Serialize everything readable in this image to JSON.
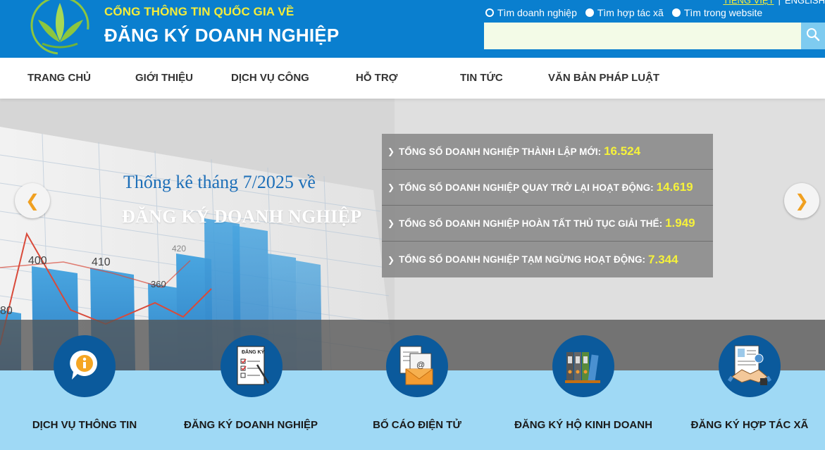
{
  "header": {
    "subtitle": "CỔNG THÔNG TIN QUỐC GIA VỀ",
    "title": "ĐĂNG KÝ DOANH NGHIỆP",
    "lang_vi": "TIẾNG VIỆT",
    "lang_en": "ENGLISH",
    "lang_sep": "|",
    "logo_icon": "leaf-logo-icon"
  },
  "search": {
    "options": [
      {
        "label": "Tìm doanh nghiệp",
        "checked": true
      },
      {
        "label": "Tìm hợp tác xã",
        "checked": false
      },
      {
        "label": "Tìm trong website",
        "checked": false
      }
    ],
    "placeholder": "",
    "value": "",
    "button_icon": "search-icon"
  },
  "nav": {
    "items": [
      "TRANG CHỦ",
      "GIỚI THIỆU",
      "DỊCH VỤ CÔNG",
      "HỖ TRỢ",
      "TIN TỨC",
      "VĂN BẢN PHÁP LUẬT"
    ]
  },
  "hero": {
    "line1": "Thống kê tháng 7/2025 về",
    "line2": "ĐĂNG KÝ DOANH NGHIỆP",
    "chart_labels": [
      "400",
      "410",
      "360",
      "420",
      "80"
    ],
    "stats": [
      {
        "label": "TỔNG SỐ DOANH NGHIỆP THÀNH LẬP MỚI:",
        "value": "16.524"
      },
      {
        "label": "TỔNG SỐ DOANH NGHIỆP QUAY TRỞ LẠI HOẠT ĐỘNG:",
        "value": "14.619"
      },
      {
        "label": "TỔNG SỐ DOANH NGHIỆP HOÀN TẤT THỦ TỤC GIẢI THỂ:",
        "value": "1.949"
      },
      {
        "label": "TỔNG SỐ DOANH NGHIỆP TẠM NGỪNG HOẠT ĐỘNG:",
        "value": "7.344"
      }
    ],
    "prev_icon": "chevron-left-icon",
    "next_icon": "chevron-right-icon"
  },
  "services": [
    {
      "label": "DỊCH VỤ THÔNG TIN",
      "icon": "info-bubble-icon"
    },
    {
      "label": "ĐĂNG KÝ DOANH NGHIỆP",
      "icon": "registration-form-icon",
      "icon_text": "ĐĂNG KÝ"
    },
    {
      "label": "BỐ CÁO ĐIỆN TỬ",
      "icon": "email-document-icon"
    },
    {
      "label": "ĐĂNG KÝ HỘ KINH DOANH",
      "icon": "binders-icon"
    },
    {
      "label": "ĐĂNG KÝ HỢP TÁC XÃ",
      "icon": "handshake-contract-icon"
    }
  ],
  "colors": {
    "header_bg": "#0a7fcf",
    "subtitle": "#f4ec3a",
    "stat_number": "#f6f23a",
    "service_circle": "#0b5a9c",
    "service_strip": "#9fd9f5",
    "arrow": "#f0a020"
  }
}
